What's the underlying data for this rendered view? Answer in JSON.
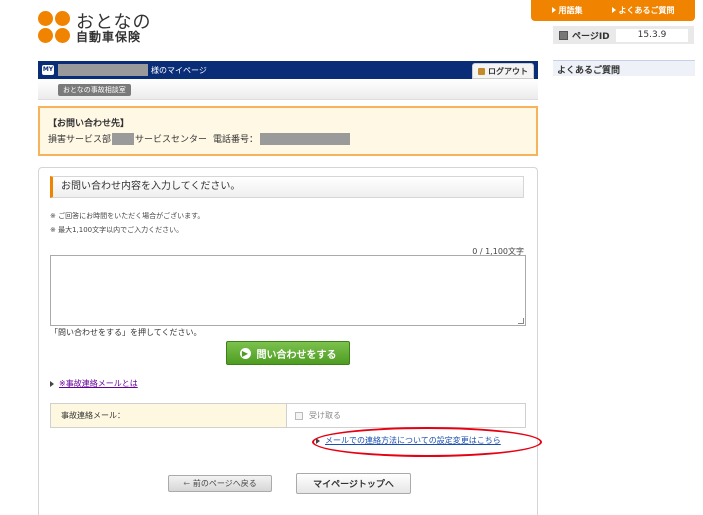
{
  "brand": {
    "line1": "おとなの",
    "line2": "自動車保険",
    "accent_color": "#f08300"
  },
  "top_links": {
    "glossary": "用語集",
    "faq": "よくあるご質問"
  },
  "page_id": {
    "label": "ページID",
    "value": "15.3.9"
  },
  "sidebar": {
    "faq_title": "よくあるご質問"
  },
  "mypage_bar": {
    "badge": "MY",
    "suffix": "様のマイページ",
    "logout_label": "ログアウト",
    "bar_color": "#0a2d78"
  },
  "sub_bar": {
    "tag": "おとなの事故相談室"
  },
  "contact": {
    "title": "【お問い合わせ先】",
    "dept_prefix": "損害サービス部",
    "center_text": "サービスセンター",
    "phone_label": "電話番号："
  },
  "form": {
    "heading": "お問い合わせ内容を入力してください。",
    "note1": "※ ご回答にお時間をいただく場合がございます。",
    "note2": "※ 最大1,100文字以内でご入力ください。",
    "counter": "0 / 1,100文字",
    "press_note": "「問い合わせをする」を押してください。",
    "submit_label": "問い合わせをする"
  },
  "links": {
    "accident_mail_about": "※事故連絡メールとは",
    "mail_settings_change": "メールでの連絡方法についての設定変更はこちら"
  },
  "mail_table": {
    "label": "事故連絡メール：",
    "checkbox_label": "受け取る"
  },
  "buttons": {
    "back_label": "前のページへ戻る",
    "mypage_top_label": "マイページトップへ"
  }
}
